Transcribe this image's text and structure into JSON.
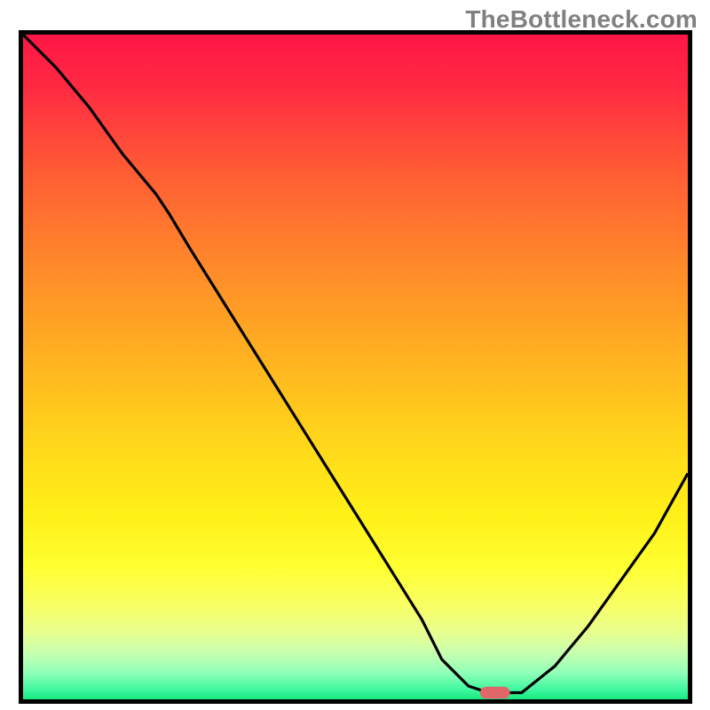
{
  "watermark": "TheBottleneck.com",
  "chart_data": {
    "type": "line",
    "title": "",
    "xlabel": "",
    "ylabel": "",
    "x_range": [
      0,
      100
    ],
    "y_range": [
      0,
      100
    ],
    "series": [
      {
        "name": "curve",
        "x": [
          0,
          5,
          10,
          15,
          20,
          22,
          25,
          30,
          35,
          40,
          45,
          50,
          55,
          60,
          63,
          67,
          70,
          72,
          75,
          80,
          85,
          90,
          95,
          100
        ],
        "y": [
          100,
          95,
          89,
          82,
          76,
          73,
          68,
          60,
          52,
          44,
          36,
          28,
          20,
          12,
          6,
          2,
          1,
          1,
          1,
          5,
          11,
          18,
          25,
          34
        ]
      }
    ],
    "marker": {
      "x": 71,
      "y": 1,
      "color": "#e06767",
      "w": 4.5,
      "h": 1.8
    },
    "gradient_stops": [
      {
        "offset": 0.0,
        "color": "#ff1646"
      },
      {
        "offset": 0.08,
        "color": "#ff2a42"
      },
      {
        "offset": 0.2,
        "color": "#ff5a35"
      },
      {
        "offset": 0.35,
        "color": "#ff8a2a"
      },
      {
        "offset": 0.5,
        "color": "#ffb620"
      },
      {
        "offset": 0.62,
        "color": "#ffd81a"
      },
      {
        "offset": 0.72,
        "color": "#fff018"
      },
      {
        "offset": 0.8,
        "color": "#ffff30"
      },
      {
        "offset": 0.86,
        "color": "#f8ff66"
      },
      {
        "offset": 0.9,
        "color": "#e8ff90"
      },
      {
        "offset": 0.93,
        "color": "#c8ffb0"
      },
      {
        "offset": 0.96,
        "color": "#90ffb8"
      },
      {
        "offset": 0.985,
        "color": "#40f8a0"
      },
      {
        "offset": 1.0,
        "color": "#18e880"
      }
    ]
  }
}
